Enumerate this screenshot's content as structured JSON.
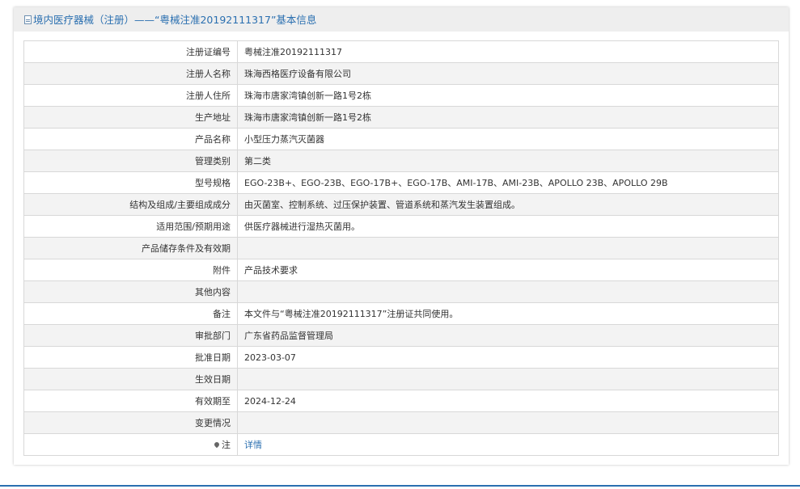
{
  "header": {
    "title": "境内医疗器械（注册）——“粤械注准20192111317”基本信息",
    "icon": "document-icon"
  },
  "rows": [
    {
      "label": "注册证编号",
      "value": "粤械注准20192111317"
    },
    {
      "label": "注册人名称",
      "value": "珠海西格医疗设备有限公司"
    },
    {
      "label": "注册人住所",
      "value": "珠海市唐家湾镇创新一路1号2栋"
    },
    {
      "label": "生产地址",
      "value": "珠海市唐家湾镇创新一路1号2栋"
    },
    {
      "label": "产品名称",
      "value": "小型压力蒸汽灭菌器"
    },
    {
      "label": "管理类别",
      "value": "第二类"
    },
    {
      "label": "型号规格",
      "value": "EGO-23B+、EGO-23B、EGO-17B+、EGO-17B、AMI-17B、AMI-23B、APOLLO 23B、APOLLO 29B"
    },
    {
      "label": "结构及组成/主要组成成分",
      "value": "由灭菌室、控制系统、过压保护装置、管道系统和蒸汽发生装置组成。"
    },
    {
      "label": "适用范围/预期用途",
      "value": "供医疗器械进行湿热灭菌用。"
    },
    {
      "label": "产品储存条件及有效期",
      "value": ""
    },
    {
      "label": "附件",
      "value": "产品技术要求"
    },
    {
      "label": "其他内容",
      "value": ""
    },
    {
      "label": "备注",
      "value": "本文件与“粤械注准20192111317”注册证共同使用。"
    },
    {
      "label": "审批部门",
      "value": "广东省药品监督管理局"
    },
    {
      "label": "批准日期",
      "value": "2023-03-07"
    },
    {
      "label": "生效日期",
      "value": ""
    },
    {
      "label": "有效期至",
      "value": "2024-12-24"
    },
    {
      "label": "变更情况",
      "value": ""
    }
  ],
  "note": {
    "label": "注",
    "icon": "pin-icon",
    "link_text": "详情"
  },
  "colors": {
    "accent": "#2a6fb0",
    "header_bg": "#eeeeee",
    "row_alt_bg": "#f3f3f3",
    "border": "#d8d8d8"
  }
}
